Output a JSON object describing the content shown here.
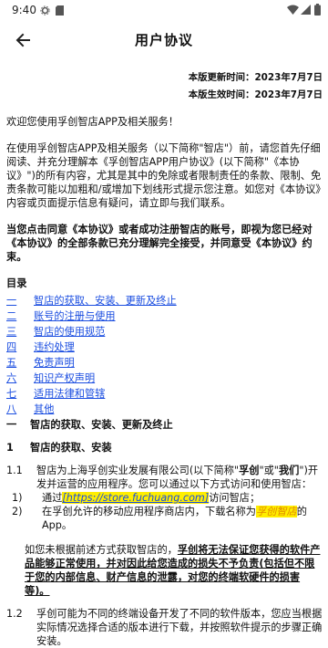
{
  "status": {
    "time": "9:40"
  },
  "appbar": {
    "title": "用户协议"
  },
  "meta": {
    "updated_label": "本版更新时间：",
    "updated_value": "2023年7月7日",
    "effective_label": "本版生效时间：",
    "effective_value": "2023年7月7日"
  },
  "intro": {
    "welcome": "欢迎您使用孚创智店APP及相关服务！",
    "p1": "在使用孚创智店APP及相关服务（以下简称\"智店\"）前，请您首先仔细阅读、并充分理解本《孚创智店APP用户协议》(以下简称\"《本协议》\")的所有内容，尤其是其中的免除或者限制责任的条款、限制、免责条款可能以加粗和/或增加下划线形式提示您注意。如您对《本协议》内容或页面提示信息有疑问，请立即与我们联系。",
    "p2": "当您点击同意《本协议》或者成功注册智店的账号，即视为您已经对《本协议》的全部条款已充分理解完全接受，并同意受《本协议》约束。"
  },
  "toc": {
    "title": "目录",
    "items": [
      {
        "num": "一",
        "label": "智店的获取、安装、更新及终止"
      },
      {
        "num": "二",
        "label": "账号的注册与使用"
      },
      {
        "num": "三",
        "label": "智店的使用规范"
      },
      {
        "num": "四",
        "label": "违约处理"
      },
      {
        "num": "五",
        "label": "免责声明"
      },
      {
        "num": "六",
        "label": "知识产权声明"
      },
      {
        "num": "七",
        "label": "适用法律和管辖"
      },
      {
        "num": "八",
        "label": "其他"
      }
    ]
  },
  "section1": {
    "heading_num": "一",
    "heading": "智店的获取、安装、更新及终止",
    "sub_num": "1",
    "sub_title": "智店的获取、安装",
    "c11_num": "1.1",
    "c11_text_a": "智店为上海孚创实业发展有限公司(以下简称\"",
    "c11_bold1": "孚创",
    "c11_text_b": "\"或\"",
    "c11_bold2": "我们",
    "c11_text_c": "\")开发并运营的应用程序。您可以通过以下方式访问和使用智店：",
    "li1_num": "1)",
    "li1_pre": "通过",
    "li1_url": "[https://store.fuchuang.com]",
    "li1_post": "访问智店；",
    "li2_num": "2)",
    "li2_pre": "在孚创允许的移动应用程序商店内，下载名称为",
    "li2_name": "孚创智店",
    "li2_post": "的App。",
    "warn_pre": "如您未根据前述方式获取智店的，",
    "warn_bold": "孚创将无法保证您获得的软件产品能够正常使用，并对因此给您造成的损失不予负责(包括但不限于您的内部信息、财产信息的泄露，对您的终端软硬件的损害等)。",
    "c12_num": "1.2",
    "c12_text": "孚创可能为不同的终端设备开发了不同的软件版本，您应当根据实际情况选择合适的版本进行下载，并按照软件提示的步骤正确安装。"
  }
}
